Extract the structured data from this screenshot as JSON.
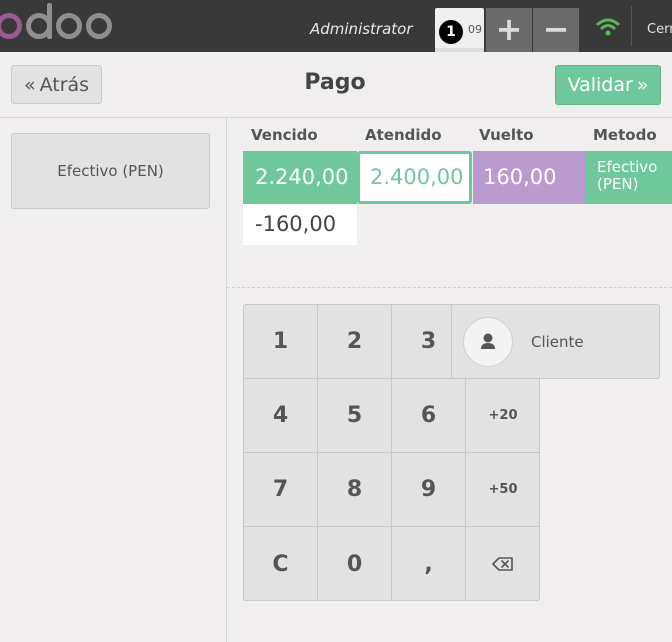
{
  "topbar": {
    "user": "Administrator",
    "order_number": "1",
    "order_time": "09",
    "add_order": "+",
    "remove_order": "−",
    "close_label": "Cerrar"
  },
  "header": {
    "back_label": "Atrás",
    "title": "Pago",
    "validate_label": "Validar"
  },
  "payment_methods": [
    {
      "label": "Efectivo (PEN)"
    }
  ],
  "paymentlines": {
    "columns": {
      "due": "Vencido",
      "tendered": "Atendido",
      "change": "Vuelto",
      "method": "Metodo"
    },
    "line": {
      "due": "2.240,00",
      "tendered": "2.400,00",
      "change": "160,00",
      "method": "Efectivo (PEN)"
    },
    "remaining": "-160,00"
  },
  "numpad": {
    "keys": [
      "1",
      "2",
      "3",
      "4",
      "5",
      "6",
      "+20",
      "7",
      "8",
      "9",
      "+50",
      "C",
      "0",
      ","
    ],
    "backspace_icon": "backspace-icon"
  },
  "client": {
    "label": "Cliente",
    "icon": "user-icon"
  },
  "colors": {
    "accent_green": "#6ec89b",
    "change_purple": "#b99bd0",
    "topbar": "#393939",
    "odoo_purple": "#9b5b92"
  }
}
